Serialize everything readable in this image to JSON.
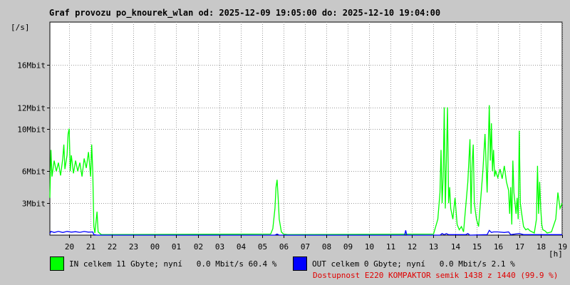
{
  "title": "Graf provozu po_knourek_wlan od: 2025-12-09 19:05:00 do: 2025-12-10 19:04:00",
  "chart_data": {
    "type": "line",
    "yunit": "[/s]",
    "xunit": "[h]",
    "ylim": [
      0,
      20
    ],
    "xlim": [
      19.1,
      43.0
    ],
    "grid": true,
    "x_ticks": [
      {
        "x": 20,
        "label": "20"
      },
      {
        "x": 21,
        "label": "21"
      },
      {
        "x": 22,
        "label": "22"
      },
      {
        "x": 23,
        "label": "23"
      },
      {
        "x": 24,
        "label": "00"
      },
      {
        "x": 25,
        "label": "01"
      },
      {
        "x": 26,
        "label": "02"
      },
      {
        "x": 27,
        "label": "03"
      },
      {
        "x": 28,
        "label": "04"
      },
      {
        "x": 29,
        "label": "05"
      },
      {
        "x": 30,
        "label": "06"
      },
      {
        "x": 31,
        "label": "07"
      },
      {
        "x": 32,
        "label": "08"
      },
      {
        "x": 33,
        "label": "09"
      },
      {
        "x": 34,
        "label": "10"
      },
      {
        "x": 35,
        "label": "11"
      },
      {
        "x": 36,
        "label": "12"
      },
      {
        "x": 37,
        "label": "13"
      },
      {
        "x": 38,
        "label": "14"
      },
      {
        "x": 39,
        "label": "15"
      },
      {
        "x": 40,
        "label": "16"
      },
      {
        "x": 41,
        "label": "17"
      },
      {
        "x": 42,
        "label": "18"
      },
      {
        "x": 43,
        "label": "19"
      }
    ],
    "y_ticks": [
      {
        "y": 3,
        "label": "3Mbit"
      },
      {
        "y": 6,
        "label": "6Mbit"
      },
      {
        "y": 10,
        "label": "10Mbit"
      },
      {
        "y": 12,
        "label": "12Mbit"
      },
      {
        "y": 16,
        "label": "16Mbit"
      }
    ],
    "series": [
      {
        "name": "IN",
        "color": "#00ff00",
        "points": [
          [
            19.1,
            3.5
          ],
          [
            19.15,
            8.0
          ],
          [
            19.2,
            5.5
          ],
          [
            19.3,
            7.0
          ],
          [
            19.4,
            6.0
          ],
          [
            19.5,
            6.8
          ],
          [
            19.6,
            5.6
          ],
          [
            19.7,
            7.2
          ],
          [
            19.75,
            8.5
          ],
          [
            19.8,
            6.2
          ],
          [
            19.9,
            7.5
          ],
          [
            19.95,
            9.5
          ],
          [
            20.0,
            10.0
          ],
          [
            20.05,
            6.0
          ],
          [
            20.1,
            7.5
          ],
          [
            20.2,
            5.8
          ],
          [
            20.3,
            7.0
          ],
          [
            20.4,
            6.0
          ],
          [
            20.5,
            6.8
          ],
          [
            20.6,
            5.5
          ],
          [
            20.7,
            7.2
          ],
          [
            20.8,
            6.3
          ],
          [
            20.9,
            7.8
          ],
          [
            21.0,
            5.5
          ],
          [
            21.05,
            8.5
          ],
          [
            21.1,
            6.0
          ],
          [
            21.15,
            0.8
          ],
          [
            21.2,
            0.2
          ],
          [
            21.3,
            2.2
          ],
          [
            21.35,
            0.3
          ],
          [
            21.5,
            0.05
          ],
          [
            29.4,
            0.1
          ],
          [
            29.5,
            0.6
          ],
          [
            29.6,
            2.5
          ],
          [
            29.65,
            4.5
          ],
          [
            29.7,
            5.2
          ],
          [
            29.75,
            3.5
          ],
          [
            29.8,
            1.5
          ],
          [
            29.9,
            0.3
          ],
          [
            30.0,
            0.1
          ],
          [
            30.2,
            0.05
          ],
          [
            37.0,
            0.1
          ],
          [
            37.2,
            1.5
          ],
          [
            37.3,
            4.0
          ],
          [
            37.35,
            8.0
          ],
          [
            37.4,
            3.0
          ],
          [
            37.45,
            5.5
          ],
          [
            37.5,
            12.0
          ],
          [
            37.55,
            2.5
          ],
          [
            37.6,
            7.0
          ],
          [
            37.65,
            12.0
          ],
          [
            37.7,
            3.0
          ],
          [
            37.75,
            4.5
          ],
          [
            37.8,
            2.5
          ],
          [
            37.9,
            1.5
          ],
          [
            38.0,
            3.5
          ],
          [
            38.1,
            1.0
          ],
          [
            38.2,
            0.5
          ],
          [
            38.3,
            0.8
          ],
          [
            38.4,
            0.3
          ],
          [
            38.6,
            5.0
          ],
          [
            38.7,
            9.0
          ],
          [
            38.75,
            2.0
          ],
          [
            38.8,
            6.5
          ],
          [
            38.85,
            8.5
          ],
          [
            38.9,
            3.0
          ],
          [
            39.0,
            1.5
          ],
          [
            39.1,
            0.8
          ],
          [
            39.3,
            6.0
          ],
          [
            39.4,
            9.5
          ],
          [
            39.5,
            4.0
          ],
          [
            39.6,
            12.2
          ],
          [
            39.65,
            7.0
          ],
          [
            39.7,
            10.5
          ],
          [
            39.75,
            6.0
          ],
          [
            39.8,
            8.0
          ],
          [
            39.85,
            5.5
          ],
          [
            39.9,
            6.0
          ],
          [
            40.0,
            5.4
          ],
          [
            40.1,
            6.2
          ],
          [
            40.2,
            5.3
          ],
          [
            40.3,
            6.5
          ],
          [
            40.4,
            5.0
          ],
          [
            40.5,
            4.2
          ],
          [
            40.55,
            2.0
          ],
          [
            40.6,
            4.5
          ],
          [
            40.65,
            1.0
          ],
          [
            40.7,
            7.0
          ],
          [
            40.75,
            4.0
          ],
          [
            40.8,
            3.0
          ],
          [
            40.85,
            2.0
          ],
          [
            40.9,
            3.5
          ],
          [
            40.95,
            1.5
          ],
          [
            41.0,
            9.8
          ],
          [
            41.05,
            3.0
          ],
          [
            41.1,
            2.2
          ],
          [
            41.2,
            0.8
          ],
          [
            41.3,
            0.5
          ],
          [
            41.4,
            0.6
          ],
          [
            41.5,
            0.4
          ],
          [
            41.6,
            0.3
          ],
          [
            41.7,
            0.2
          ],
          [
            41.8,
            1.5
          ],
          [
            41.85,
            6.5
          ],
          [
            41.9,
            2.0
          ],
          [
            41.95,
            5.0
          ],
          [
            42.0,
            2.5
          ],
          [
            42.05,
            1.0
          ],
          [
            42.1,
            0.5
          ],
          [
            42.2,
            0.4
          ],
          [
            42.3,
            0.2
          ],
          [
            42.5,
            0.3
          ],
          [
            42.7,
            1.5
          ],
          [
            42.8,
            4.0
          ],
          [
            42.9,
            2.5
          ],
          [
            43.0,
            3.0
          ]
        ]
      },
      {
        "name": "OUT",
        "color": "#0000ff",
        "points": [
          [
            19.1,
            0.15
          ],
          [
            19.15,
            0.35
          ],
          [
            19.3,
            0.25
          ],
          [
            19.5,
            0.35
          ],
          [
            19.7,
            0.25
          ],
          [
            19.9,
            0.35
          ],
          [
            20.1,
            0.28
          ],
          [
            20.3,
            0.32
          ],
          [
            20.5,
            0.26
          ],
          [
            20.7,
            0.34
          ],
          [
            20.9,
            0.28
          ],
          [
            21.1,
            0.3
          ],
          [
            21.15,
            0.05
          ],
          [
            21.3,
            0.0
          ],
          [
            29.6,
            0.0
          ],
          [
            29.7,
            0.1
          ],
          [
            29.8,
            0.0
          ],
          [
            35.65,
            0.0
          ],
          [
            35.7,
            0.45
          ],
          [
            35.75,
            0.0
          ],
          [
            37.3,
            0.0
          ],
          [
            37.4,
            0.15
          ],
          [
            37.5,
            0.05
          ],
          [
            37.6,
            0.15
          ],
          [
            37.7,
            0.05
          ],
          [
            38.5,
            0.05
          ],
          [
            38.6,
            0.15
          ],
          [
            38.7,
            0.0
          ],
          [
            39.5,
            0.05
          ],
          [
            39.6,
            0.45
          ],
          [
            39.7,
            0.25
          ],
          [
            39.8,
            0.3
          ],
          [
            40.0,
            0.3
          ],
          [
            40.3,
            0.25
          ],
          [
            40.5,
            0.3
          ],
          [
            40.6,
            0.05
          ],
          [
            40.8,
            0.1
          ],
          [
            41.0,
            0.15
          ],
          [
            41.2,
            0.05
          ],
          [
            41.5,
            0.05
          ],
          [
            42.0,
            0.05
          ],
          [
            43.0,
            0.05
          ]
        ]
      }
    ]
  },
  "legend": {
    "in": {
      "text": "IN celkem 11 Gbyte; nyní   0.0 Mbit/s 60.4 %",
      "color": "#00ff00"
    },
    "out": {
      "text": "OUT celkem 0 Gbyte; nyní   0.0 Mbit/s 2.1 %",
      "color": "#0000ff"
    }
  },
  "availability": {
    "text": "Dostupnost E220 KOMPAKTOR semik 1438 z 1440 (99.9 %)",
    "color": "#e00000"
  }
}
